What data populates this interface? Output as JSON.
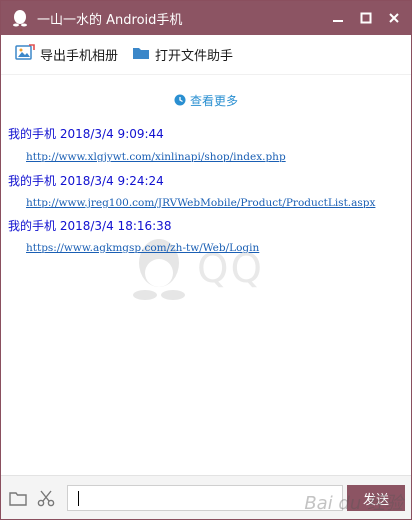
{
  "window": {
    "title": "一山一水的 Android手机",
    "colors": {
      "titlebar": "#8c5463",
      "accent": "#2a8fd1",
      "link": "#1a5fb4",
      "sender": "#1010d0"
    }
  },
  "toolbar": {
    "export_album": "导出手机相册",
    "open_assistant": "打开文件助手"
  },
  "history": {
    "view_more": "查看更多"
  },
  "messages": [
    {
      "sender": "我的手机",
      "time": "2018/3/4 9:09:44",
      "url": "http://www.xlgjywt.com/xinlinapi/shop/index.php"
    },
    {
      "sender": "我的手机",
      "time": "2018/3/4 9:24:24",
      "url": "http://www.jreg100.com/JRVWebMobile/Product/ProductList.aspx"
    },
    {
      "sender": "我的手机",
      "time": "2018/3/4 18:16:38",
      "url": "https://www.agkmgsp.com/zh-tw/Web/Login"
    }
  ],
  "watermark": {
    "text": "QQ"
  },
  "composer": {
    "value": "",
    "send_label": "发送"
  },
  "baidu_watermark": "Bai du 经验"
}
